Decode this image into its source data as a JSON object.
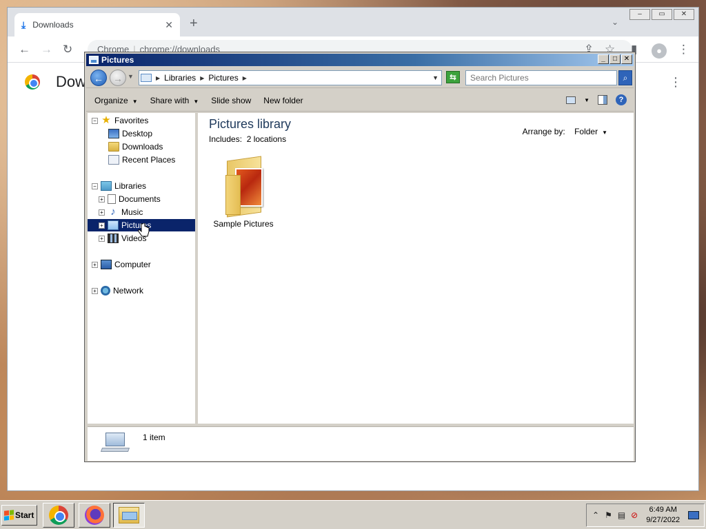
{
  "chrome": {
    "tab_title": "Downloads",
    "tab_close": "✕",
    "new_tab": "+",
    "address_scheme": "Chrome",
    "address_url": "chrome://downloads",
    "page_heading": "Dow",
    "nav_back": "←",
    "nav_forward": "→",
    "reload": "↻",
    "share": "⇪",
    "bookmark": "☆",
    "menu": "⋮"
  },
  "explorer": {
    "title": "Pictures",
    "window_buttons": {
      "minimize": "_",
      "maximize": "□",
      "close": "✕"
    },
    "address": {
      "crumbs": [
        "Libraries",
        "Pictures"
      ],
      "separator": "▶",
      "dropdown": "▼"
    },
    "search_placeholder": "Search Pictures",
    "command_bar": {
      "organize": "Organize",
      "share_with": "Share with",
      "slide_show": "Slide show",
      "new_folder": "New folder",
      "caret": "▼",
      "help": "?"
    },
    "nav_tree": {
      "favorites": "Favorites",
      "desktop": "Desktop",
      "downloads": "Downloads",
      "recent_places": "Recent Places",
      "libraries": "Libraries",
      "documents": "Documents",
      "music": "Music",
      "pictures": "Pictures",
      "videos": "Videos",
      "computer": "Computer",
      "network": "Network",
      "expand": "+",
      "collapse": "−"
    },
    "content": {
      "library_title": "Pictures library",
      "includes_label": "Includes:",
      "includes_value": "2 locations",
      "arrange_label": "Arrange by:",
      "arrange_value": "Folder",
      "folder_name": "Sample Pictures"
    },
    "status": {
      "item_count": "1 item"
    }
  },
  "taskbar": {
    "start_label": "Start",
    "clock_time": "6:49 AM",
    "clock_date": "9/27/2022",
    "tray_chevron": "⌃"
  },
  "colors": {
    "title_gradient_start": "#0a246a",
    "selection": "#0a246a",
    "library_title": "#1e395b"
  }
}
